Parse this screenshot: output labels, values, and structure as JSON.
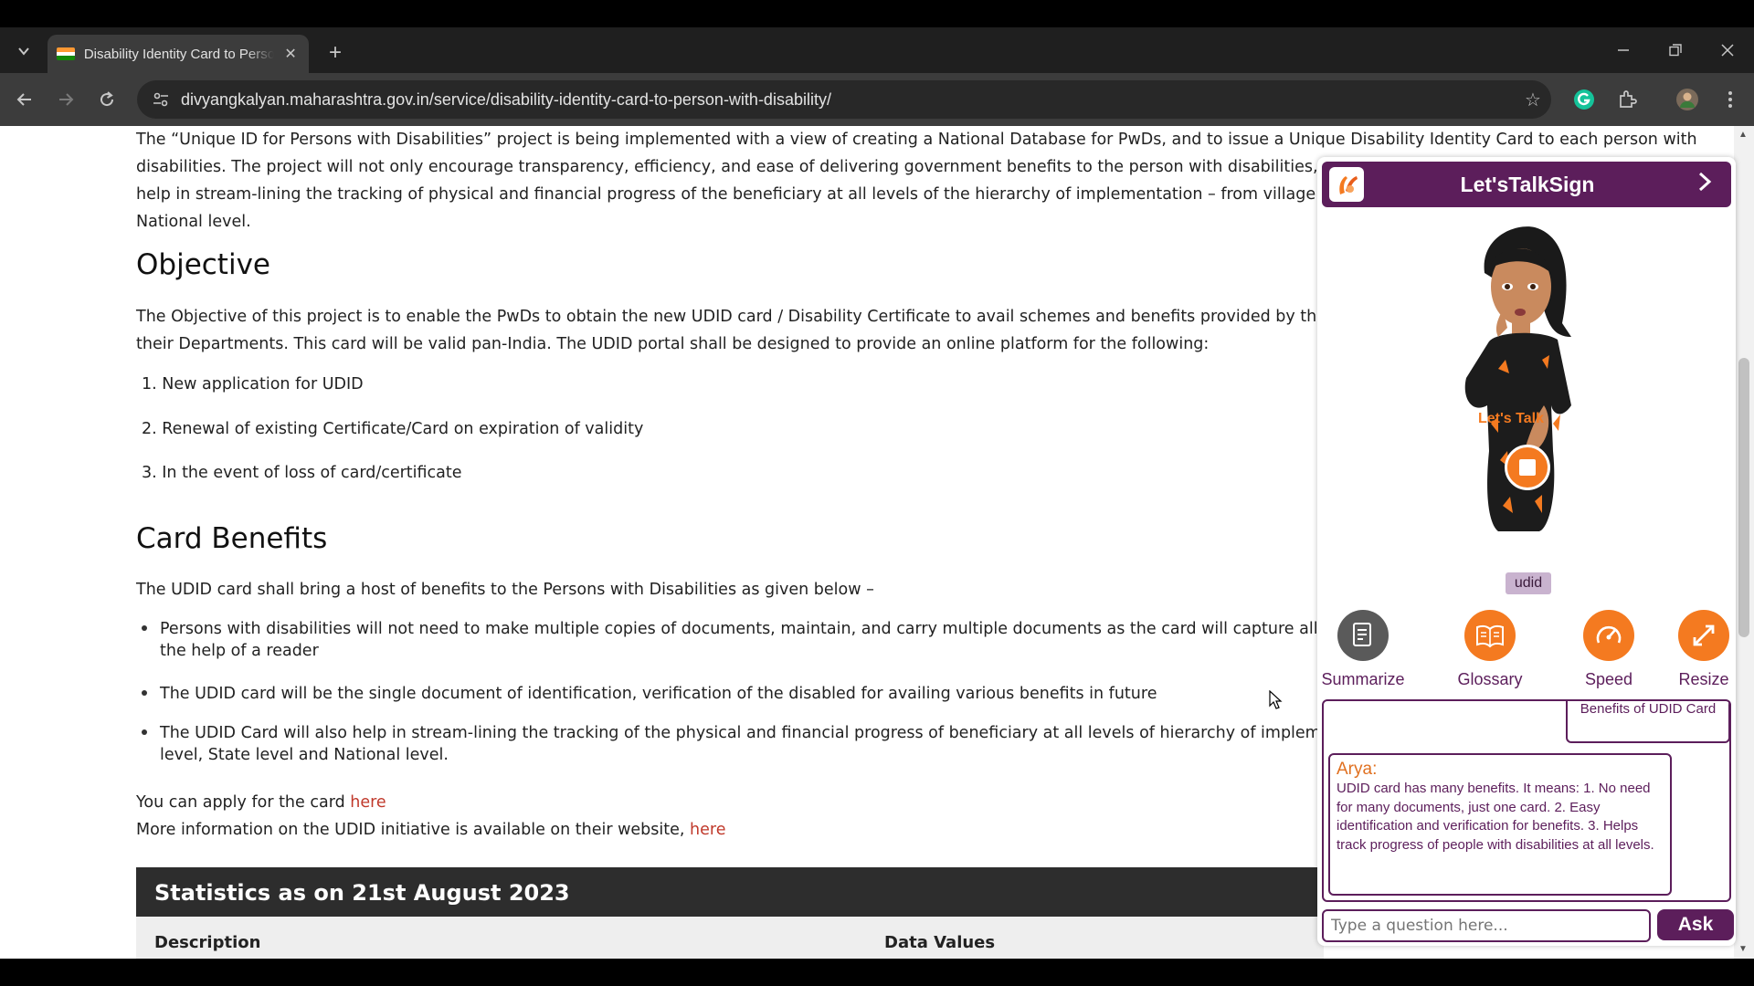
{
  "browser": {
    "tab_title": "Disability Identity Card to Person with Disability",
    "url": "divyangkalyan.maharashtra.gov.in/service/disability-identity-card-to-person-with-disability/",
    "icons": [
      "tab-list-icon",
      "close-icon",
      "plus-icon",
      "minimize-icon",
      "restore-icon",
      "window-close-icon",
      "back-icon",
      "forward-icon",
      "reload-icon",
      "site-settings-icon",
      "star-icon",
      "grammarly-icon",
      "extensions-icon",
      "profile-avatar",
      "kebab-menu-icon"
    ]
  },
  "page": {
    "intro_lines": [
      "The “Unique ID for Persons with Disabilities” project is being implemented with a view of creating a National Database for PwDs, and to issue a Unique Disability Identity Card to each person with",
      "disabilities. The project will not only encourage transparency, efficiency, and ease of delivering government benefits to the person with disabilities, but also er",
      "help in stream-lining the tracking of physical and financial progress of the beneficiary at all levels of the hierarchy of implementation – from village level, blc",
      "National level."
    ],
    "objective_heading": "Objective",
    "objective_lines": [
      "The Objective of this project is to enable the PwDs to obtain the new UDID card / Disability Certificate to avail schemes and benefits provided by the Governm",
      "their Departments. This card will be valid pan-India. The UDID portal shall be designed to provide an online platform for the following:"
    ],
    "objective_items": [
      "1. New application for UDID",
      "2. Renewal of existing Certificate/Card on expiration of validity",
      "3. In the event of loss of card/certificate"
    ],
    "benefits_heading": "Card Benefits",
    "benefits_intro": "The UDID card shall bring a host of benefits to the Persons with Disabilities as given below –",
    "benefits": [
      {
        "line1": "Persons with disabilities will not need to make multiple copies of documents, maintain, and carry multiple documents as the card will capture all the necessa",
        "line2": "the help of a reader"
      },
      {
        "line1": "The UDID card will be the single document of identification, verification of the disabled for availing various benefits in future",
        "line2": ""
      },
      {
        "line1": "The UDID Card will also help in stream-lining the tracking of the physical and financial progress of beneficiary at all levels of hierarchy of implementation – fr",
        "line2": "level, State level and National level."
      }
    ],
    "apply_text": "You can apply for the card ",
    "apply_link": "here",
    "moreinfo_text": "More information on the UDID initiative is available on their website, ",
    "moreinfo_link": "here",
    "stats_heading": "Statistics as on 21st August 2023",
    "stats_col1": "Description",
    "stats_col2": "Data Values"
  },
  "widget": {
    "title": "Let'sTalkSign",
    "avatar_tag": "udid",
    "avatar_dress_text": "Let's Talk",
    "tools": [
      {
        "label": "Summarize",
        "icon": "summarize-icon"
      },
      {
        "label": "Glossary",
        "icon": "glossary-book-icon"
      },
      {
        "label": "Speed",
        "icon": "speed-gauge-icon"
      },
      {
        "label": "Resize",
        "icon": "resize-arrows-icon"
      }
    ],
    "user_message": "Benefits of UDID Card",
    "bot_name": "Arya:",
    "bot_message": "UDID card has many benefits. It means: 1. No need for many documents, just one card. 2. Easy identification and verification for benefits. 3. Helps track progress of people with disabilities at all levels.",
    "input_placeholder": "Type a question here...",
    "ask_label": "Ask"
  },
  "colors": {
    "widget_purple": "#5c1e5b",
    "widget_orange": "#f47a20",
    "link_red": "#c0392b",
    "chrome_dark": "#1f1f1f"
  }
}
